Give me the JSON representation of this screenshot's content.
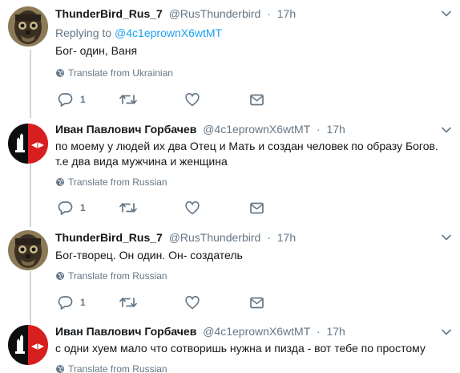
{
  "tweets": [
    {
      "name": "ThunderBird_Rus_7",
      "handle": "@RusThunderbird",
      "separator": "·",
      "time": "17h",
      "replying_prefix": "Replying to",
      "replying_to": "@4c1eprownX6wtMT",
      "text": "Бог- один, Ваня",
      "translate": "Translate from Ukrainian",
      "reply_count": "1",
      "avatar_icon": "skull-helmet-avatar"
    },
    {
      "name": "Иван Павлович Горбачев",
      "handle": "@4c1eprownX6wtMT",
      "separator": "·",
      "time": "17h",
      "text": "по моему у людей их два Отец и Мать и создан человек по образу Богов. т.е два вида мужчина и женщина",
      "translate": "Translate from Russian",
      "reply_count": "1",
      "avatar_icon": "red-black-emblem-avatar"
    },
    {
      "name": "ThunderBird_Rus_7",
      "handle": "@RusThunderbird",
      "separator": "·",
      "time": "17h",
      "text": "Бог-творец. Он один. Он- создатель",
      "translate": "Translate from Russian",
      "reply_count": "1",
      "avatar_icon": "skull-helmet-avatar"
    },
    {
      "name": "Иван Павлович Горбачев",
      "handle": "@4c1eprownX6wtMT",
      "separator": "·",
      "time": "17h",
      "text": "с одни хуем мало что сотворишь нужна и пизда - вот тебе по простому",
      "translate": "Translate from Russian",
      "avatar_icon": "red-black-emblem-avatar"
    }
  ],
  "colors": {
    "accent": "#1da1f2",
    "muted": "#657786",
    "thread_line": "#ccd6dd",
    "emblem_red": "#d81f1f"
  }
}
